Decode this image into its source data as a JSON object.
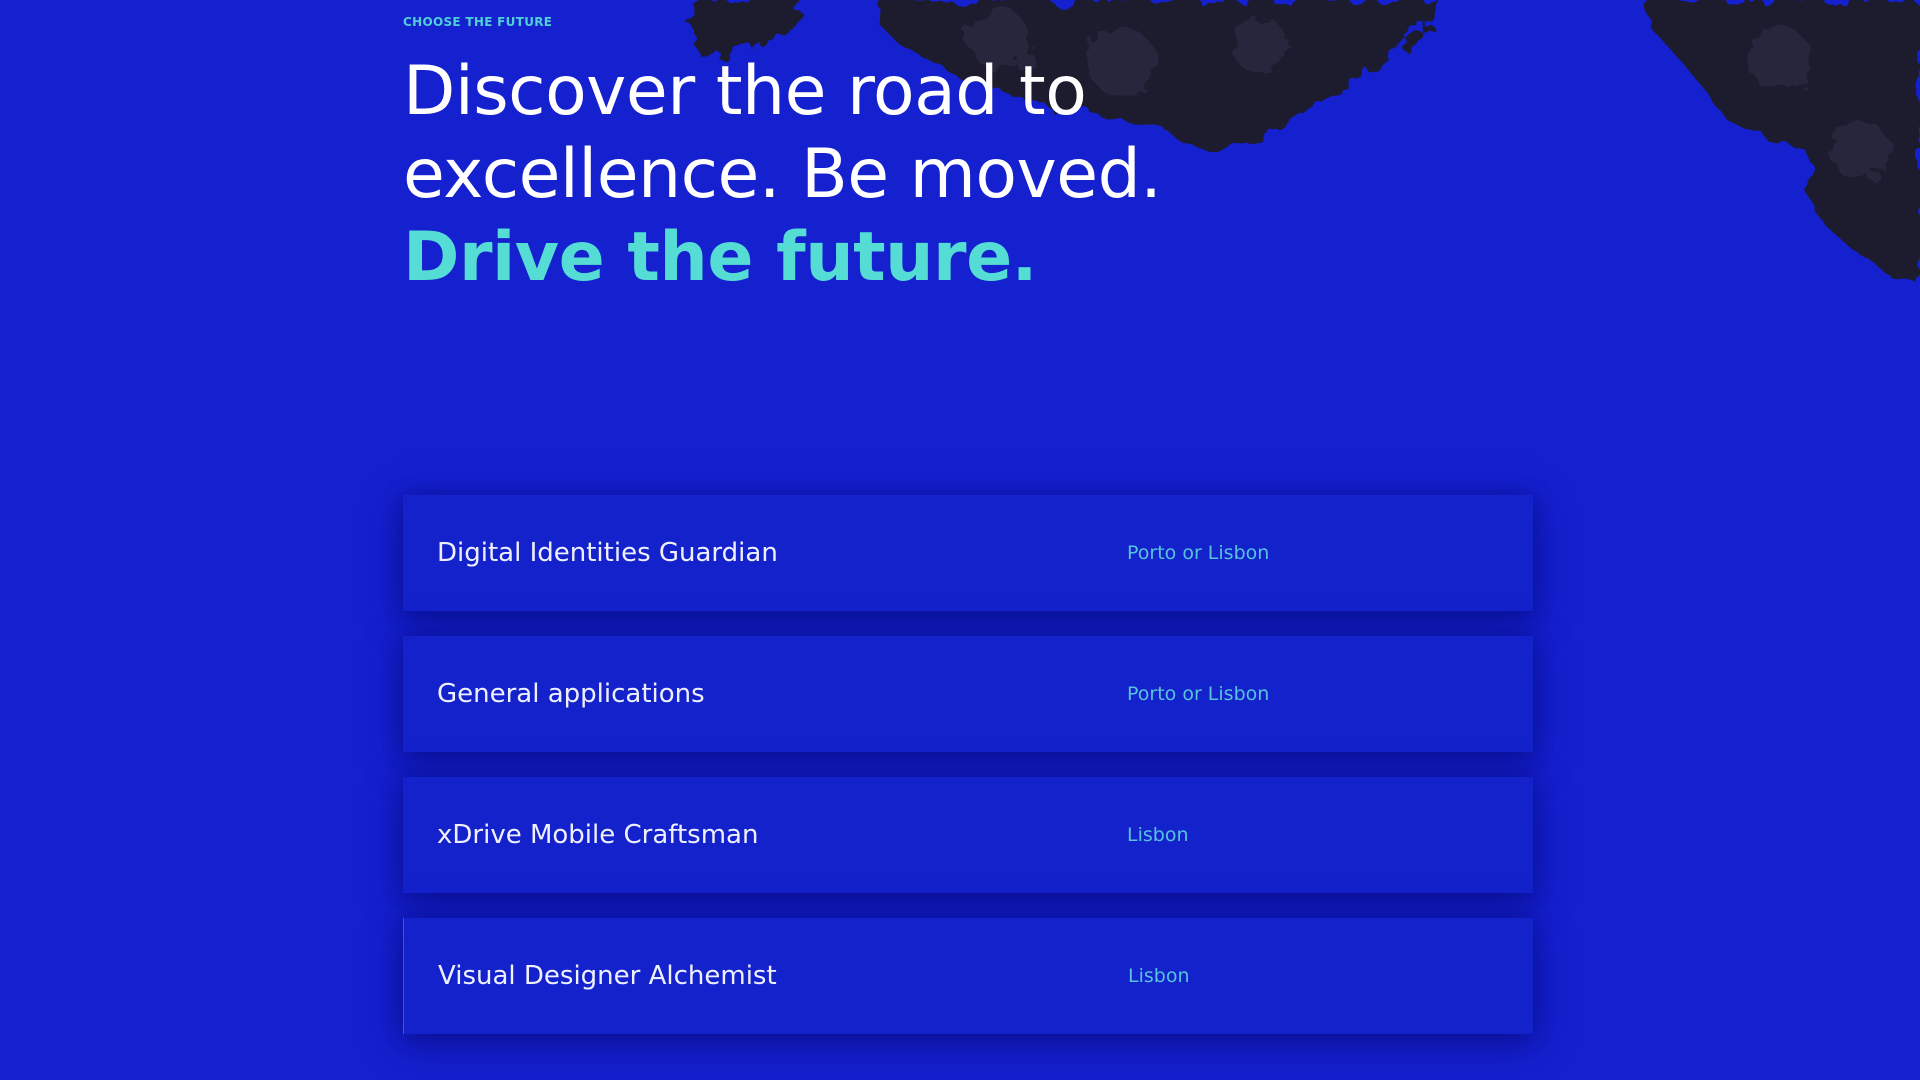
{
  "hero": {
    "eyebrow": "CHOOSE THE FUTURE",
    "headline_line1": "Discover the road to",
    "headline_line2": "excellence. Be moved.",
    "headline_accent": "Drive the future."
  },
  "jobs": [
    {
      "title": "Digital Identities Guardian",
      "location": "Porto or Lisbon"
    },
    {
      "title": "General applications",
      "location": "Porto or Lisbon"
    },
    {
      "title": "xDrive Mobile Craftsman",
      "location": "Lisbon"
    },
    {
      "title": "Visual Designer Alchemist",
      "location": "Lisbon"
    }
  ],
  "colors": {
    "background": "#1520cf",
    "accent": "#55ddd5",
    "location": "#57c3dd",
    "foliage": "#1b1c2e"
  },
  "icons": [
    "foliage-art"
  ]
}
